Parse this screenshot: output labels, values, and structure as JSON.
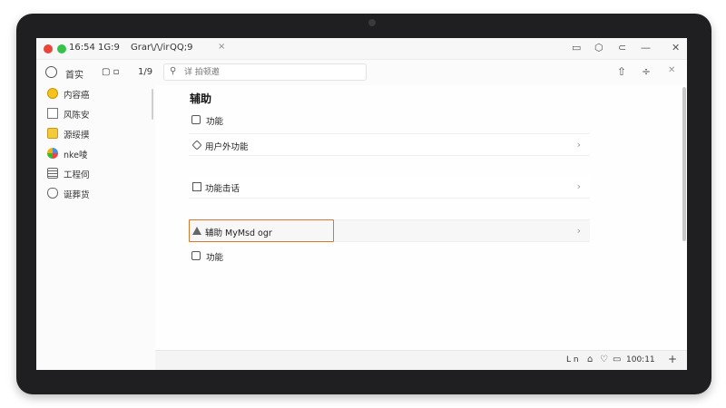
{
  "titlebar": {
    "time": "16:54",
    "tab1": "1G:9",
    "tab2": "Grar\\/\\/ir",
    "tab3": "QQ;9",
    "tab_close": "×",
    "win_min": "▭",
    "win_circle": "⬡",
    "win_restore": "⊂",
    "win_dash": "—",
    "win_close": "✕"
  },
  "toolbar": {
    "home_label": "首实",
    "grid_label": "▢ ▫",
    "page_num": "1/9",
    "search_placeholder": "详 拍顿邀",
    "share_icon": "⇧",
    "split_icon": "÷",
    "close_icon": "✕"
  },
  "sidebar": {
    "items": [
      {
        "label": "内容癌",
        "icon": "yellow-circle-icon"
      },
      {
        "label": "风陈安",
        "icon": "square-icon"
      },
      {
        "label": "源绥摸",
        "icon": "yellow-box-icon"
      },
      {
        "label": "nke㖫",
        "icon": "globe-icon"
      },
      {
        "label": "工程伺",
        "icon": "list-icon"
      },
      {
        "label": "诞葬货",
        "icon": "shield-icon"
      }
    ]
  },
  "main": {
    "title": "辅助",
    "top_item": "功能",
    "rows": [
      {
        "label": "用户外功能",
        "icon": "tag-icon"
      },
      {
        "label": "功能击话",
        "icon": "square-icon"
      },
      {
        "label": "辅助 MyMsd ogr",
        "icon": "bell-icon"
      }
    ],
    "bottom_item": "功能",
    "chevron": "›"
  },
  "statusbar": {
    "icons_text": "L n",
    "wifi": "⌂",
    "shield": "♡",
    "battery": "▭",
    "time": "100:11",
    "plus": "+"
  }
}
